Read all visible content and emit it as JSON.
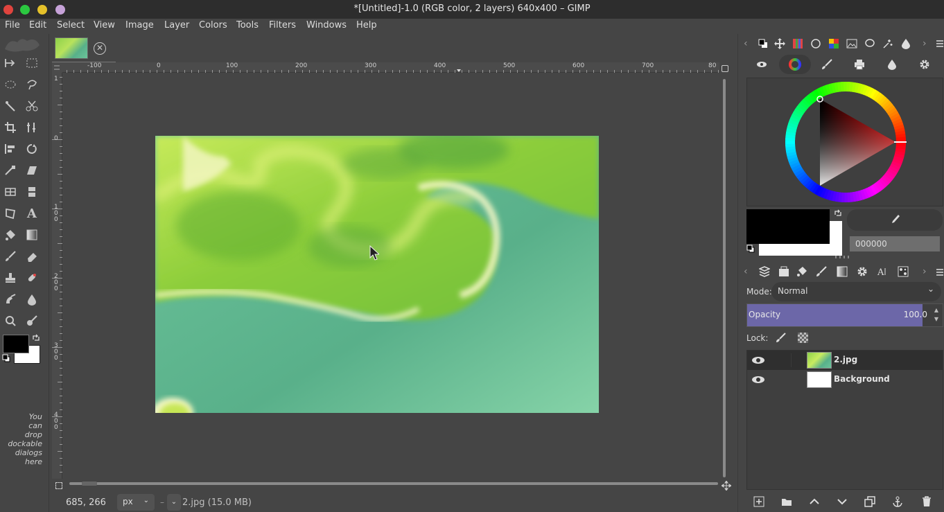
{
  "window": {
    "title": "*[Untitled]-1.0 (RGB color, 2 layers) 640x400 – GIMP",
    "traffic_lights": [
      "#e0443e",
      "#2bc840",
      "#e5c12a",
      "#c6a2d8"
    ]
  },
  "menubar": {
    "items": [
      "File",
      "Edit",
      "Select",
      "View",
      "Image",
      "Layer",
      "Colors",
      "Tools",
      "Filters",
      "Windows",
      "Help"
    ]
  },
  "toolbox": {
    "tools": [
      "move-tool-icon",
      "rect-select-icon",
      "ellipse-select-icon",
      "free-select-icon",
      "fuzzy-select-icon",
      "scissors-select-icon",
      "crop-tool-icon",
      "unified-transform-icon",
      "align-tool-icon",
      "warp-transform-icon",
      "handle-transform-icon",
      "shear-tool-icon",
      "perspective-tool-icon",
      "flip-tool-icon",
      "cage-transform-icon",
      "text-tool-icon",
      "bucket-fill-icon",
      "gradient-tool-icon",
      "paintbrush-icon",
      "eraser-icon",
      "clone-tool-icon",
      "heal-tool-icon",
      "smudge-tool-icon",
      "ink-tool-icon",
      "dodge-burn-icon",
      "mypaint-brush-icon"
    ],
    "drop_hint_lines": [
      "You",
      "can",
      "drop",
      "dockable",
      "dialogs",
      "here"
    ],
    "fg_color": "#000000",
    "bg_color": "#ffffff"
  },
  "image_tab": {
    "thumbnail": "image-thumbnail"
  },
  "rulers": {
    "horizontal_labels": [
      "-100",
      "0",
      "100",
      "200",
      "300",
      "400",
      "500",
      "600",
      "700",
      "80"
    ],
    "vertical_labels": [
      "1",
      "0",
      "1 0 0",
      "2 0 0",
      "3 0 0",
      "4 0 0"
    ]
  },
  "statusbar": {
    "coords": "685, 266",
    "unit": "px",
    "dash": "–",
    "status": "2.jpg (15.0 MB)"
  },
  "dock_top": {
    "tabs": [
      "fg-bg-icon",
      "move-icon",
      "palette-icon",
      "circle-icon",
      "color-grid-icon",
      "image-icon",
      "lasso-icon",
      "brush-icon",
      "drop-icon"
    ],
    "selector_tabs": [
      "eye-icon",
      "color-wheel-icon",
      "brush-icon",
      "printer-icon",
      "watercolor-icon",
      "gear-icon"
    ],
    "hex_value": "000000",
    "fg_color": "#000000",
    "bg_color": "#ffffff"
  },
  "dock_layers": {
    "tabs": [
      "layers-icon",
      "paths-icon",
      "channels-icon",
      "brush-icon",
      "gradient-icon",
      "gear-icon",
      "text-icon",
      "pattern-icon"
    ],
    "mode_label": "Mode:",
    "mode_value": "Normal",
    "opacity_label": "Opacity",
    "opacity_value": "100.0",
    "opacity_fraction": 0.95,
    "lock_label": "Lock:",
    "layers": [
      {
        "name": "2.jpg",
        "selected": true
      },
      {
        "name": "Background",
        "selected": false
      }
    ],
    "footer_buttons": [
      "new-layer-icon",
      "new-group-icon",
      "raise-layer-icon",
      "lower-layer-icon",
      "duplicate-layer-icon",
      "anchor-layer-icon",
      "delete-layer-icon"
    ]
  }
}
